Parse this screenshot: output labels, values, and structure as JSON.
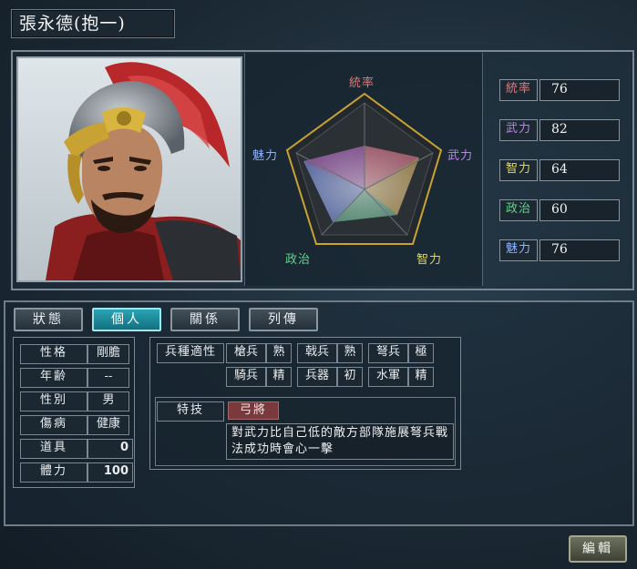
{
  "title": "張永德(抱一)",
  "radar": {
    "labels": {
      "tong": "統率",
      "wu": "武力",
      "zhi": "智力",
      "zheng": "政治",
      "mei": "魅力"
    }
  },
  "stats": [
    {
      "label": "統率",
      "value": "76",
      "color": "#e07a7a"
    },
    {
      "label": "武力",
      "value": "82",
      "color": "#c080f0"
    },
    {
      "label": "智力",
      "value": "64",
      "color": "#e8d84a"
    },
    {
      "label": "政治",
      "value": "60",
      "color": "#5fd48a"
    },
    {
      "label": "魅力",
      "value": "76",
      "color": "#8fb4ff"
    }
  ],
  "tabs": [
    "狀態",
    "個人",
    "關係",
    "列傳"
  ],
  "active_tab": "個人",
  "personal": [
    {
      "label": "性格",
      "value": "剛膽"
    },
    {
      "label": "年齢",
      "value": "--"
    },
    {
      "label": "性別",
      "value": "男"
    },
    {
      "label": "傷病",
      "value": "健康"
    },
    {
      "label": "道具",
      "value": "0"
    },
    {
      "label": "體力",
      "value": "100"
    }
  ],
  "aptitude": {
    "header": "兵種適性",
    "items": [
      {
        "type": "槍兵",
        "grade": "熟"
      },
      {
        "type": "戟兵",
        "grade": "熟"
      },
      {
        "type": "弩兵",
        "grade": "極"
      },
      {
        "type": "騎兵",
        "grade": "精"
      },
      {
        "type": "兵器",
        "grade": "初"
      },
      {
        "type": "水軍",
        "grade": "精"
      }
    ]
  },
  "skill": {
    "header": "特技",
    "name": "弓將",
    "description": "對武力比自己低的敵方部隊施展弩兵戰法成功時會心一擊"
  },
  "edit_button": "編輯"
}
